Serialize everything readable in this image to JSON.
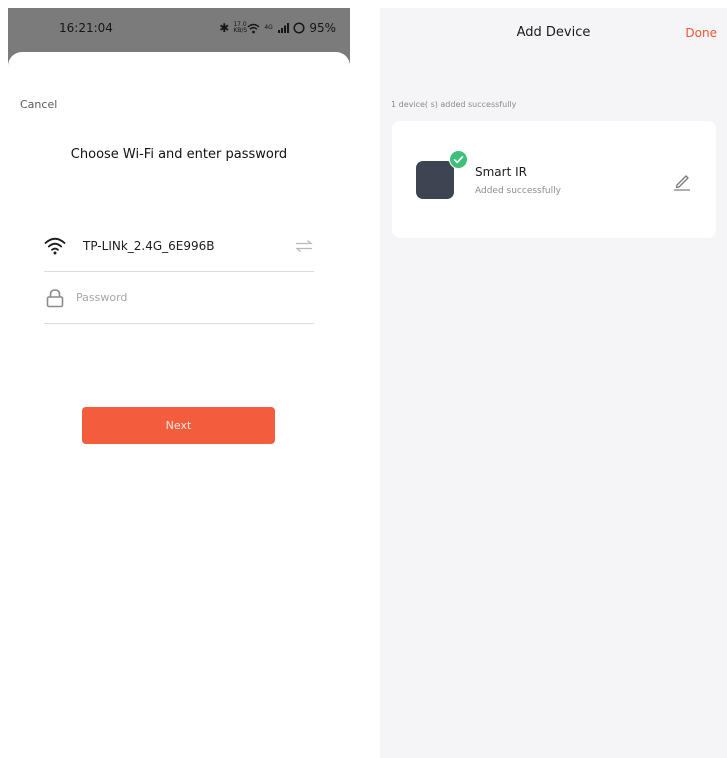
{
  "left_screen": {
    "status_bar": {
      "time": "16:21:04",
      "network_speed_value": "17.0",
      "network_speed_unit": "KB/S",
      "signal_label": "4G",
      "battery": "95%"
    },
    "cancel_label": "Cancel",
    "title": "Choose Wi-Fi and enter password",
    "wifi": {
      "icon": "wifi-icon",
      "ssid": "TP-LINk_2.4G_6E996B",
      "switch_icon": "switch-network-icon"
    },
    "password": {
      "icon": "lock-icon",
      "placeholder": "Password",
      "value": ""
    },
    "next_label": "Next"
  },
  "right_screen": {
    "title": "Add Device",
    "done_label": "Done",
    "summary": "1 device( s)  added successfully",
    "device": {
      "name": "Smart IR",
      "status": "Added successfully",
      "icon": "device-icon",
      "badge_icon": "check-badge-icon",
      "edit_icon": "edit-pencil-icon"
    }
  },
  "colors": {
    "accent": "#f35d3e",
    "done_text": "#f05533",
    "success_badge": "#3ec07a",
    "device_tile": "#3e4452",
    "right_background": "#f5f5f7",
    "scrim": "#7b7b7b"
  }
}
